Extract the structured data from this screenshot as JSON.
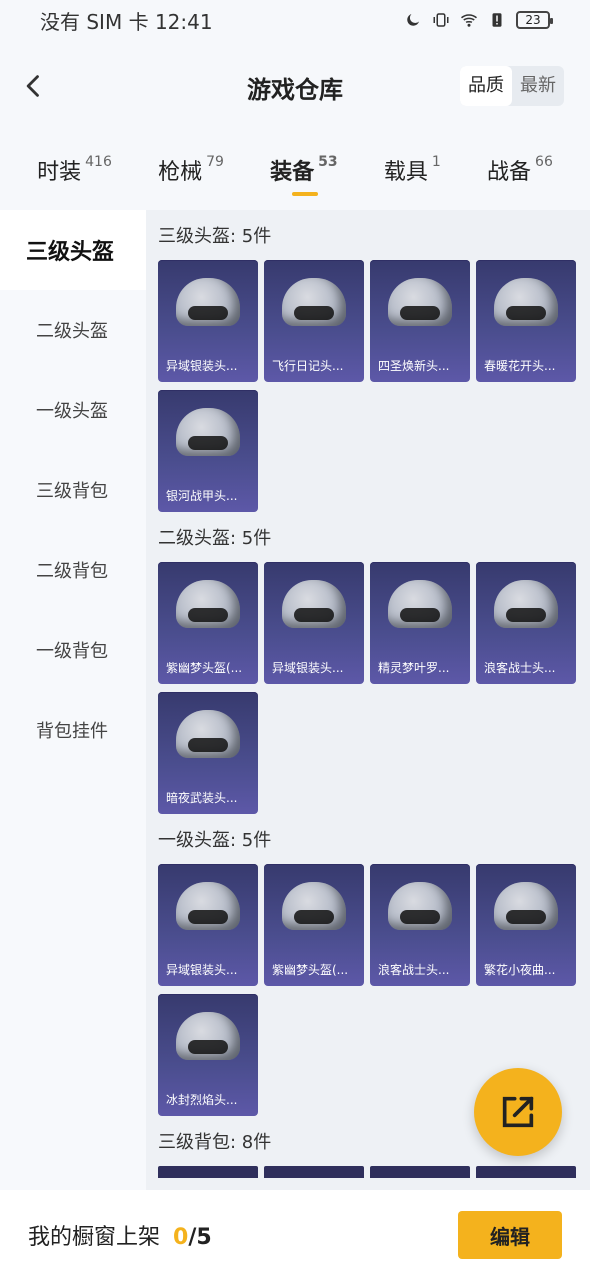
{
  "status_bar": {
    "carrier": "没有 SIM 卡",
    "time": "12:41",
    "battery": "23"
  },
  "header": {
    "title": "游戏仓库",
    "sort": {
      "quality": "品质",
      "latest": "最新"
    }
  },
  "tabs": [
    {
      "label": "时装",
      "count": "416"
    },
    {
      "label": "枪械",
      "count": "79"
    },
    {
      "label": "装备",
      "count": "53"
    },
    {
      "label": "载具",
      "count": "1"
    },
    {
      "label": "战备",
      "count": "66"
    }
  ],
  "sidebar": {
    "items": [
      {
        "label": "三级头盔"
      },
      {
        "label": "二级头盔"
      },
      {
        "label": "一级头盔"
      },
      {
        "label": "三级背包"
      },
      {
        "label": "二级背包"
      },
      {
        "label": "一级背包"
      },
      {
        "label": "背包挂件"
      }
    ]
  },
  "sections": [
    {
      "title": "三级头盔: 5件",
      "items": [
        "异域银装头...",
        "飞行日记头...",
        "四圣焕新头...",
        "春暖花开头...",
        "银河战甲头..."
      ]
    },
    {
      "title": "二级头盔: 5件",
      "items": [
        "紫幽梦头盔(...",
        "异域银装头...",
        "精灵梦叶罗...",
        "浪客战士头...",
        "暗夜武装头..."
      ]
    },
    {
      "title": "一级头盔: 5件",
      "items": [
        "异域银装头...",
        "紫幽梦头盔(...",
        "浪客战士头...",
        "繁花小夜曲...",
        "冰封烈焰头..."
      ]
    },
    {
      "title": "三级背包: 8件",
      "items": []
    }
  ],
  "bottom_bar": {
    "label": "我的橱窗上架",
    "current": "0",
    "total": "/5",
    "edit_button": "编辑"
  },
  "colors": {
    "accent": "#f4b21d",
    "card_bg": "#4b4e8f"
  },
  "icons": {
    "back": "chevron-left-icon",
    "share": "external-link-icon",
    "moon": "moon-icon",
    "vibrate": "vibrate-icon",
    "wifi": "wifi-icon",
    "alert": "alert-icon",
    "battery": "battery-icon"
  }
}
